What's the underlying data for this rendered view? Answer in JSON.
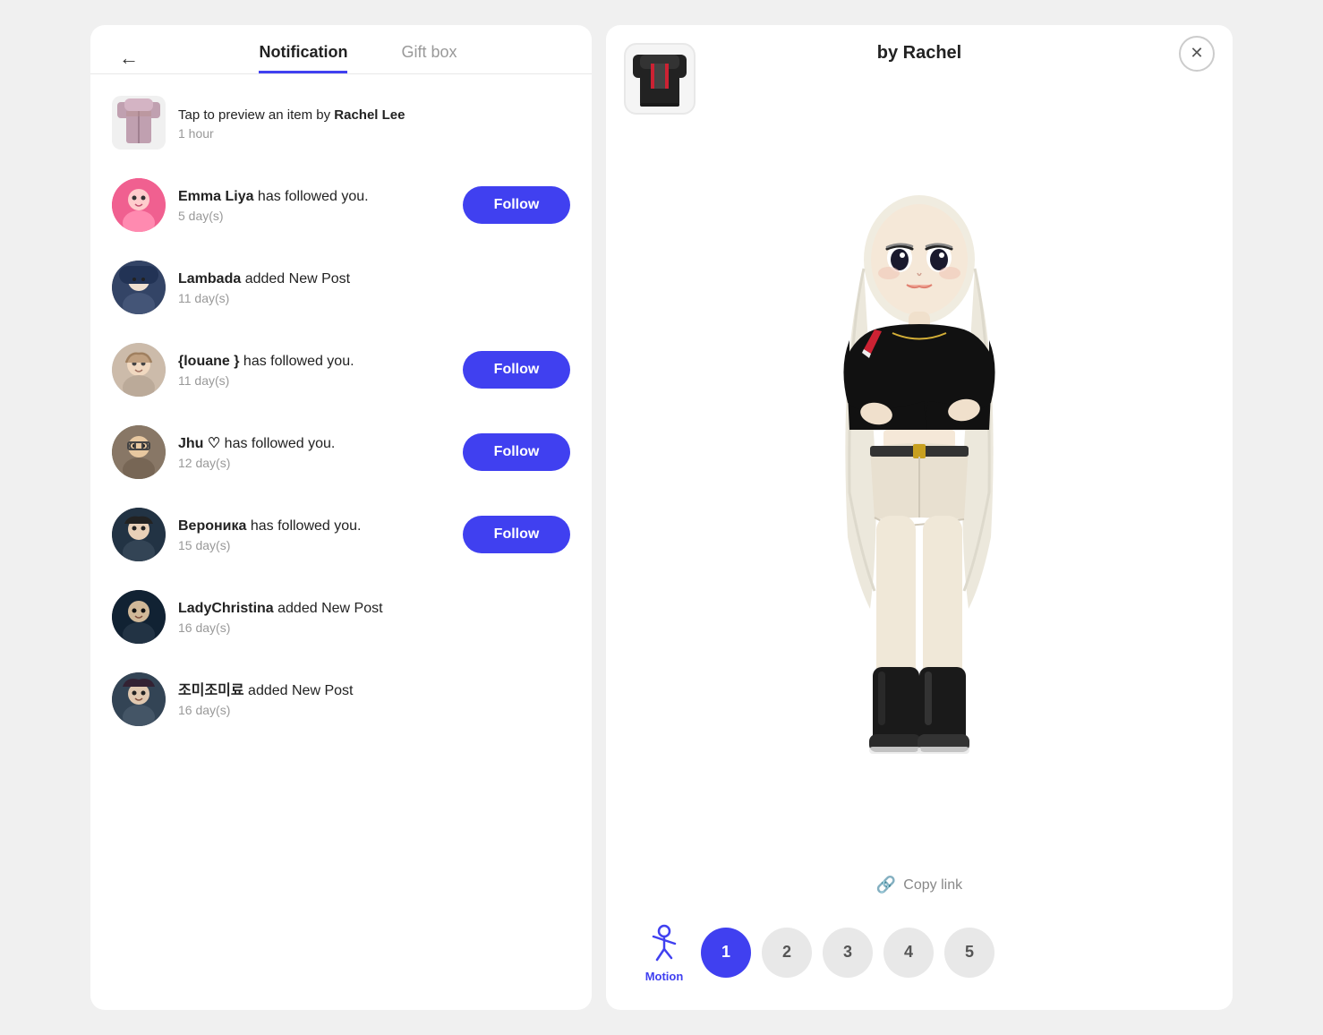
{
  "left": {
    "back_label": "←",
    "tabs": [
      {
        "id": "notification",
        "label": "Notification",
        "active": true
      },
      {
        "id": "giftbox",
        "label": "Gift box",
        "active": false
      }
    ],
    "notifications": [
      {
        "id": "rachel-item",
        "type": "item",
        "text_prefix": "Tap to preview an item by ",
        "bold": "Rachel Lee",
        "time": "1 hour",
        "has_follow": false,
        "avatar_class": "avatar-rachel",
        "avatar_emoji": "👗"
      },
      {
        "id": "emma",
        "type": "follow",
        "name": "Emma Liya",
        "text_suffix": " has followed you.",
        "time": "5 day(s)",
        "has_follow": true,
        "follow_label": "Follow",
        "avatar_class": "avatar-emma",
        "avatar_emoji": "🌸"
      },
      {
        "id": "lambada",
        "type": "post",
        "name": "Lambada",
        "text_suffix": " added New Post",
        "time": "11 day(s)",
        "has_follow": false,
        "avatar_class": "avatar-lambada",
        "avatar_emoji": "👩"
      },
      {
        "id": "louane",
        "type": "follow",
        "name": "{louane }",
        "text_suffix": " has followed you.",
        "time": "11 day(s)",
        "has_follow": true,
        "follow_label": "Follow",
        "avatar_class": "avatar-louane",
        "avatar_emoji": "👤"
      },
      {
        "id": "jhu",
        "type": "follow",
        "name": "Jhu ♡",
        "text_suffix": " has followed you.",
        "time": "12 day(s)",
        "has_follow": true,
        "follow_label": "Follow",
        "avatar_class": "avatar-jhu",
        "avatar_emoji": "👓"
      },
      {
        "id": "veronika",
        "type": "follow",
        "name": "Вероника",
        "text_suffix": " has followed you.",
        "time": "15 day(s)",
        "has_follow": true,
        "follow_label": "Follow",
        "avatar_class": "avatar-veronika",
        "avatar_emoji": "🖤"
      },
      {
        "id": "ladychristina",
        "type": "post",
        "name": "LadyChristina",
        "text_suffix": " added New Post",
        "time": "16 day(s)",
        "has_follow": false,
        "avatar_class": "avatar-ladychristina",
        "avatar_emoji": "🐱"
      },
      {
        "id": "jomio",
        "type": "post",
        "name": "조미조미료",
        "text_suffix": " added New Post",
        "time": "16 day(s)",
        "has_follow": false,
        "avatar_class": "avatar-jomio",
        "avatar_emoji": "🤳"
      }
    ]
  },
  "right": {
    "title": "by Rachel",
    "close_label": "✕",
    "copy_link_label": "Copy link",
    "motion_label": "Motion",
    "number_buttons": [
      "1",
      "2",
      "3",
      "4",
      "5"
    ],
    "active_number": "1"
  }
}
